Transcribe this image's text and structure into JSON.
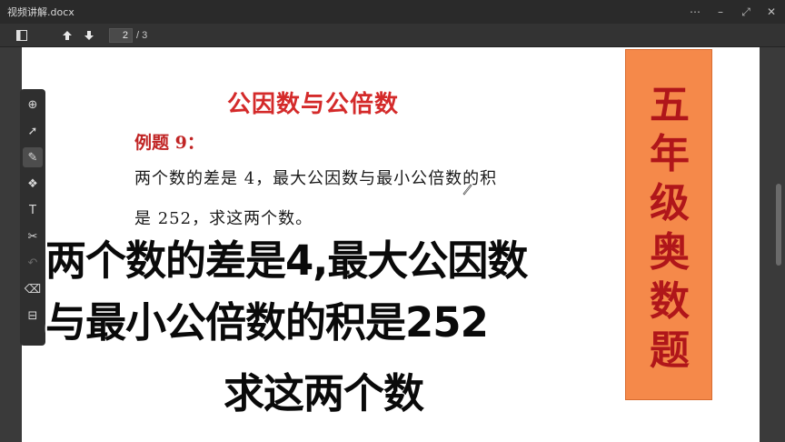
{
  "window": {
    "title": "视频讲解.docx",
    "controls": {
      "menu": "⋯",
      "minimize": "–",
      "restore": "⤢",
      "close": "✕"
    }
  },
  "toolbar": {
    "current_page": "2",
    "total_pages": "/ 3"
  },
  "document": {
    "heading": "公因数与公倍数",
    "example_label": "例题 9：",
    "line1": "两个数的差是 4，最大公因数与最小公倍数的积",
    "line2": "是 252，求这两个数。"
  },
  "banner": {
    "chars": [
      "五",
      "年",
      "级",
      "奥",
      "数",
      "题"
    ],
    "color": "#f5894a",
    "text_color": "#b0161a"
  },
  "subtitle": {
    "line1": "两个数的差是4,最大公因数",
    "line2": "与最小公倍数的积是252",
    "line3": "求这两个数"
  },
  "tools": [
    {
      "name": "add-page-icon",
      "glyph": "⊕"
    },
    {
      "name": "select-arrow-icon",
      "glyph": "➚"
    },
    {
      "name": "pen-icon",
      "glyph": "✎"
    },
    {
      "name": "shapes-icon",
      "glyph": "❖"
    },
    {
      "name": "text-tool-icon",
      "glyph": "T"
    },
    {
      "name": "scissors-icon",
      "glyph": "✂"
    },
    {
      "name": "undo-icon",
      "glyph": "↶"
    },
    {
      "name": "eraser-icon",
      "glyph": "⌫"
    },
    {
      "name": "toolbox-icon",
      "glyph": "⊟"
    }
  ],
  "colors": {
    "heading_red": "#d42a2a",
    "banner_orange": "#f5894a"
  }
}
